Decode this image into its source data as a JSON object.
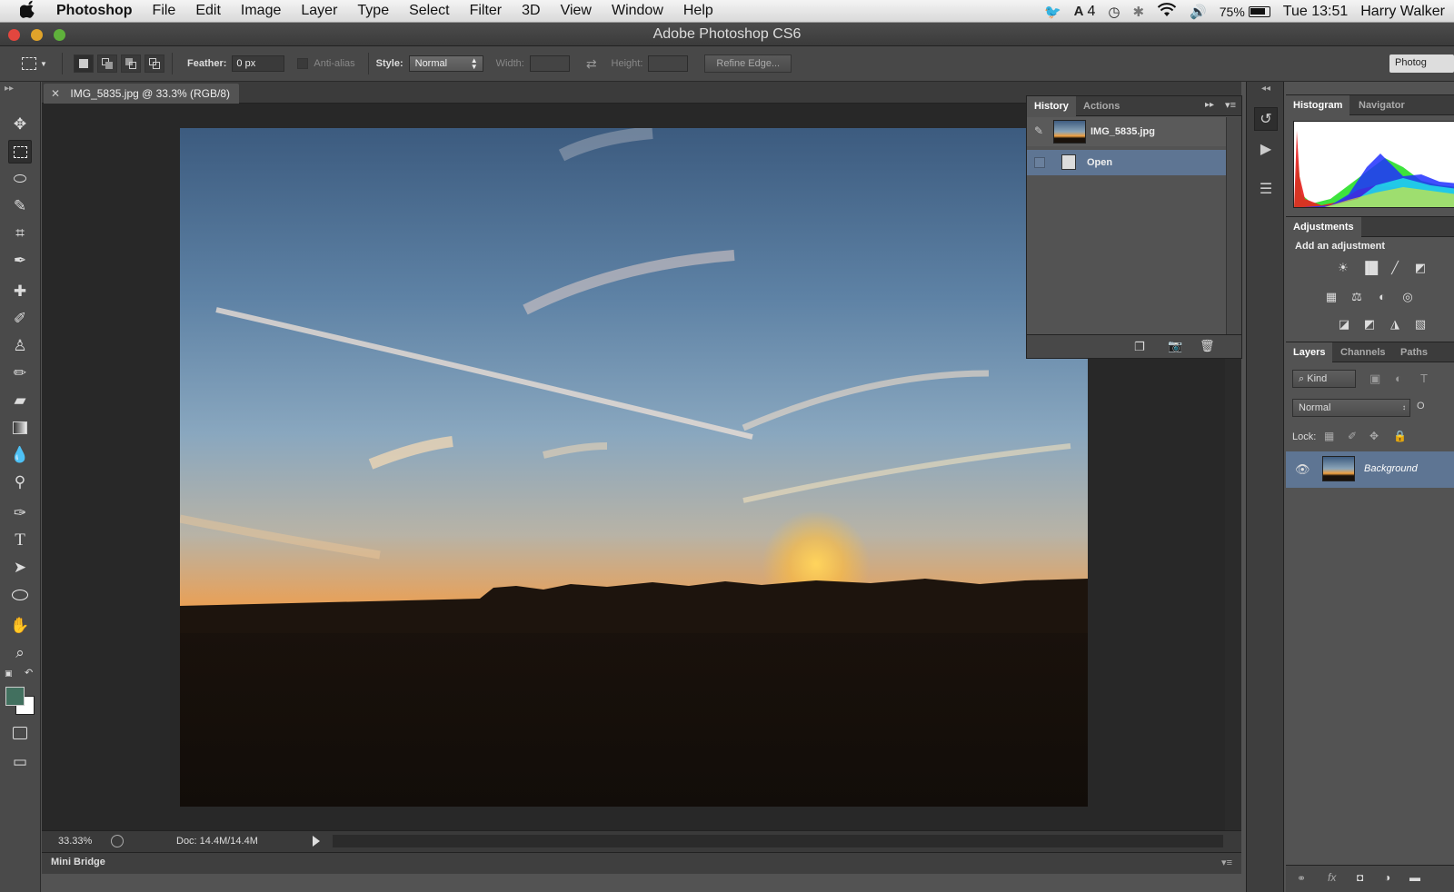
{
  "menubar": {
    "app_name": "Photoshop",
    "items": [
      "File",
      "Edit",
      "Image",
      "Layer",
      "Type",
      "Select",
      "Filter",
      "3D",
      "View",
      "Window",
      "Help"
    ],
    "status": {
      "notification_count": "4",
      "battery": "75%",
      "clock": "Tue 13:51",
      "user": "Harry Walker"
    }
  },
  "window": {
    "title": "Adobe Photoshop CS6"
  },
  "options": {
    "feather_label": "Feather:",
    "feather_value": "0 px",
    "antialias_label": "Anti-alias",
    "style_label": "Style:",
    "style_value": "Normal",
    "width_label": "Width:",
    "height_label": "Height:",
    "refine_edge": "Refine Edge...",
    "workspace": "Photog"
  },
  "document": {
    "tab_title": "IMG_5835.jpg @ 33.3% (RGB/8)",
    "zoom": "33.33%",
    "doc_info": "Doc: 14.4M/14.4M"
  },
  "minibridge": {
    "label": "Mini Bridge"
  },
  "history": {
    "tabs": [
      "History",
      "Actions"
    ],
    "snapshot_name": "IMG_5835.jpg",
    "states": [
      "Open"
    ]
  },
  "panels": {
    "histogram_tabs": [
      "Histogram",
      "Navigator"
    ],
    "adjustments_tab": "Adjustments",
    "adjustments_title": "Add an adjustment",
    "layer_tabs": [
      "Layers",
      "Channels",
      "Paths"
    ],
    "kind_filter": "Kind",
    "blend_mode": "Normal",
    "opacity_label_partial": "O",
    "lock_label": "Lock:",
    "layers": [
      "Background"
    ]
  }
}
